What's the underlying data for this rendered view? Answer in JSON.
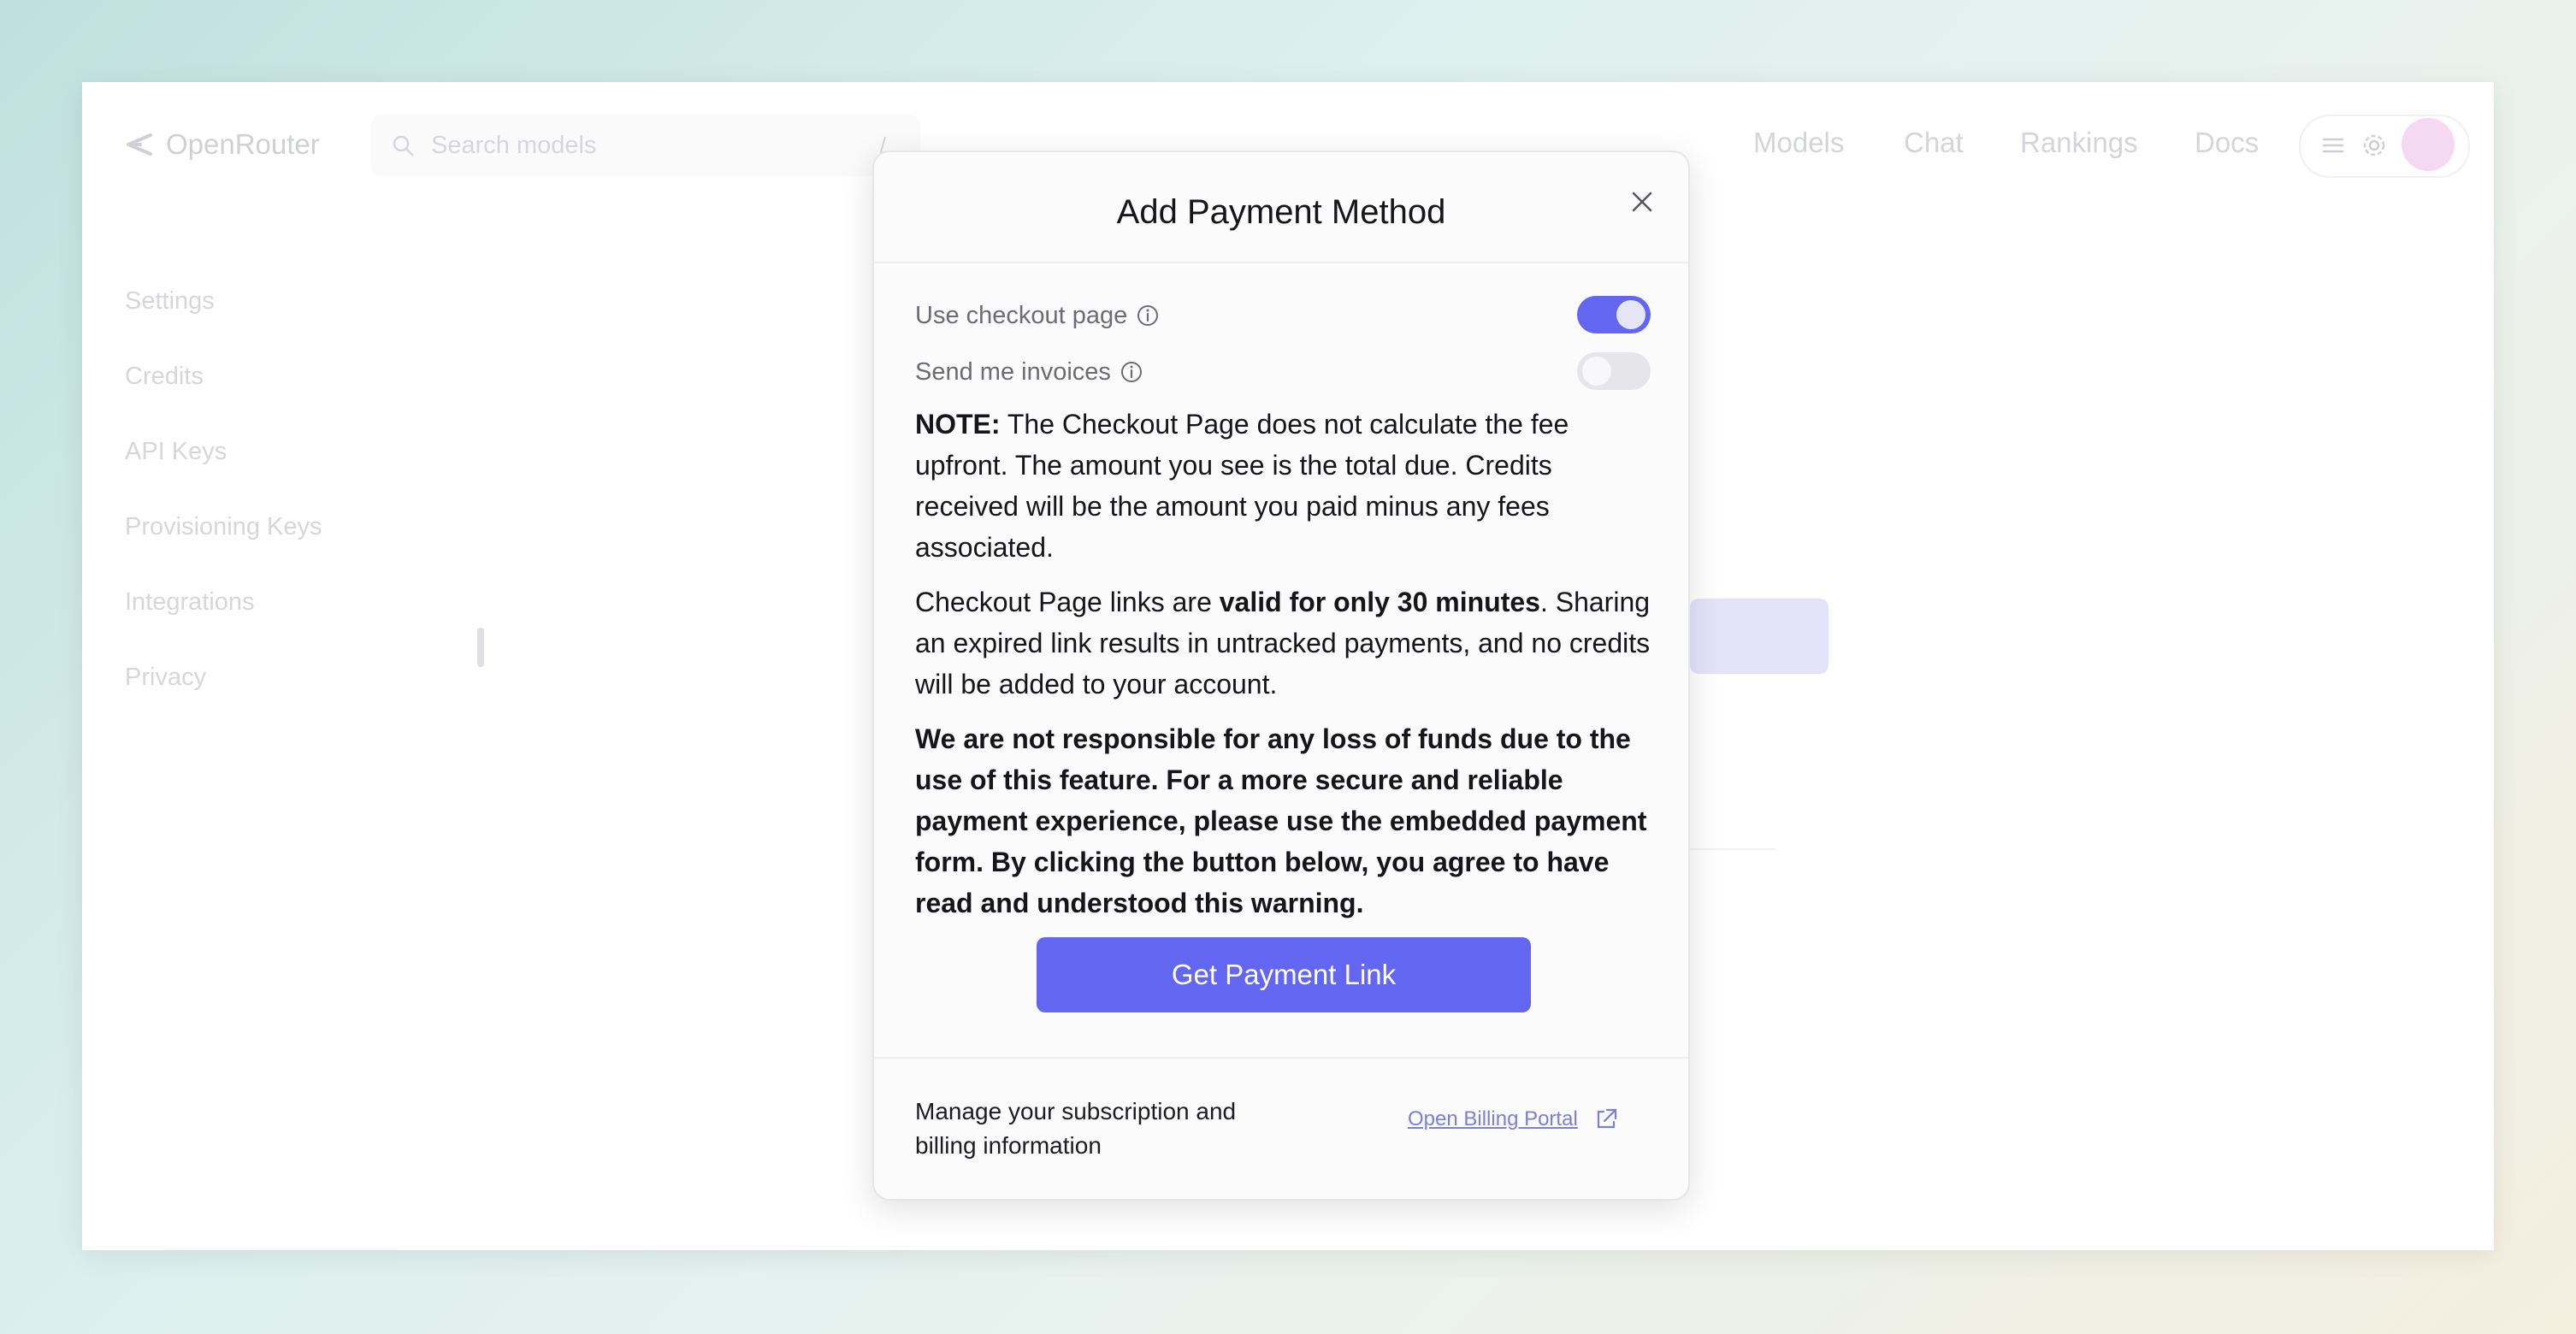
{
  "app": {
    "name": "OpenRouter"
  },
  "header": {
    "search_placeholder": "Search models",
    "search_shortcut": "/",
    "nav": [
      "Models",
      "Chat",
      "Rankings",
      "Docs"
    ]
  },
  "sidebar": {
    "items": [
      {
        "label": "Settings"
      },
      {
        "label": "Credits"
      },
      {
        "label": "API Keys"
      },
      {
        "label": "Provisioning Keys"
      },
      {
        "label": "Integrations"
      },
      {
        "label": "Privacy"
      }
    ]
  },
  "modal": {
    "title": "Add Payment Method",
    "toggles": [
      {
        "label": "Use checkout page",
        "on": true
      },
      {
        "label": "Send me invoices",
        "on": false
      }
    ],
    "note": {
      "lead": "NOTE:",
      "text": " The Checkout Page does not calculate the fee upfront. The amount you see is the total due. Credits received will be the amount you paid minus any fees associated."
    },
    "validity": {
      "pre": "Checkout Page links are ",
      "bold": "valid for only 30 minutes",
      "post": ". Sharing an expired link results in untracked payments, and no credits will be added to your account."
    },
    "warning": "We are not responsible for any loss of funds due to the use of this feature. For a more secure and reliable payment experience, please use the embedded payment form. By clicking the button below, you agree to have read and understood this warning.",
    "cta_label": "Get Payment Link",
    "footer_text": "Manage your subscription and billing information",
    "portal_link": "Open Billing Portal"
  },
  "colors": {
    "accent": "#6366f1",
    "link": "#7b7fd8"
  }
}
